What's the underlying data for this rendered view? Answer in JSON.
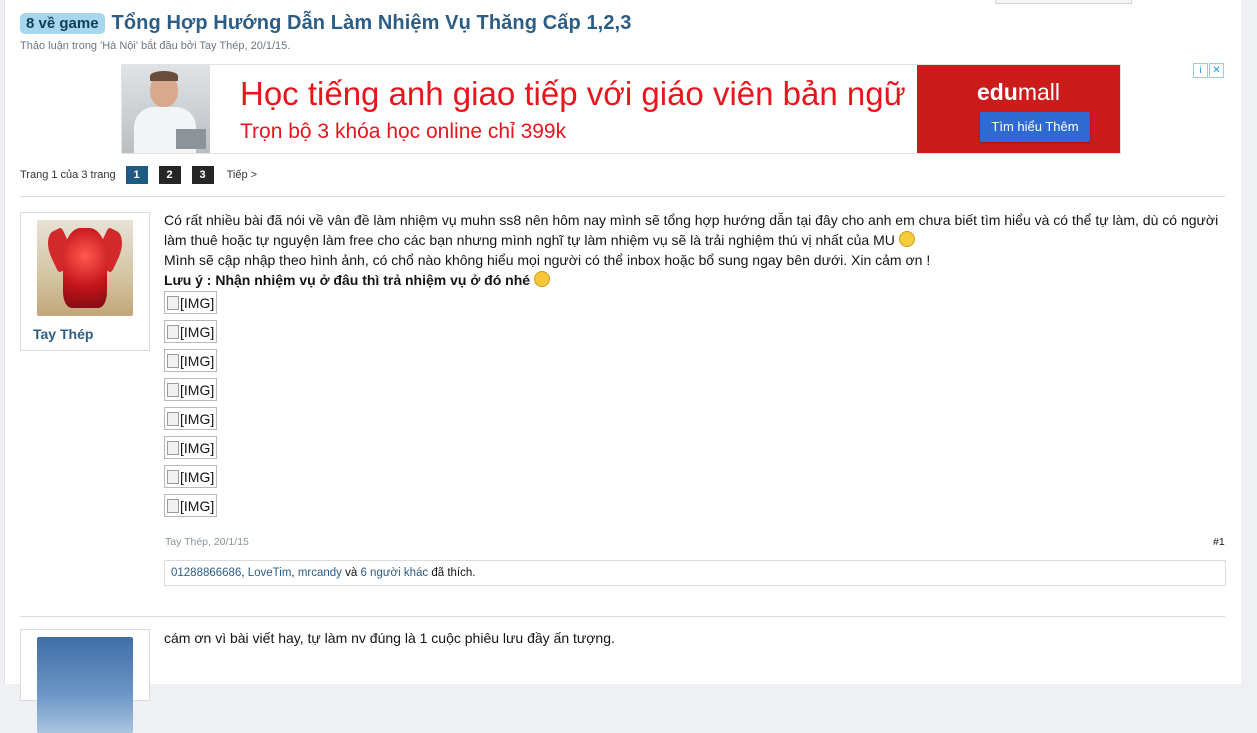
{
  "thread": {
    "prefix": "8 về game",
    "title": "Tổng Hợp Hướng Dẫn Làm Nhiệm Vụ Thăng Cấp 1,2,3",
    "meta": {
      "discussion_in": "Thảo luận trong",
      "forum": "'Hà Nội'",
      "started_by": "bắt đầu bởi",
      "author": "Tay Thép",
      "date": ", 20/1/15."
    }
  },
  "ad": {
    "headline": "Học tiếng anh giao tiếp với giáo viên bản ngữ",
    "subline": "Trọn bộ 3 khóa học online chỉ 399k",
    "brand_bold": "edu",
    "brand_rest": "mall",
    "cta": "Tìm hiểu Thêm",
    "choices_info": "i",
    "choices_close": "✕",
    "colors": {
      "text": "#e8151c",
      "brand_bg": "#cc1b1b",
      "cta_bg": "#2e6ad1"
    }
  },
  "pagination": {
    "label": "Trang 1 của 3 trang",
    "pages": [
      "1",
      "2",
      "3"
    ],
    "current": "1",
    "next": "Tiếp >"
  },
  "posts": [
    {
      "username": "Tay Thép",
      "lines": [
        "Có rất nhiều bài đã nói về vân đề làm nhiệm vụ muhn ss8 nên hôm nay mình sẽ tổng hợp hướng dẫn tại đây cho anh em chưa biết tìm hiểu và có thể tự làm, dù có người làm thuê hoặc tự nguyện làm free cho các bạn nhưng mình nghĩ tự làm nhiệm vụ sẽ là trải nghiệm thú vị nhất của MU",
        "Mình sẽ cập nhập theo hình ảnh, có chổ nào không hiểu mọi người có thể inbox hoặc bổ sung ngay bên dưới. Xin cảm ơn !",
        "Lưu ý : Nhận nhiệm vụ ở đâu thì trả nhiệm vụ ở đó nhé"
      ],
      "images": [
        "[IMG]",
        "[IMG]",
        "[IMG]",
        "[IMG]",
        "[IMG]",
        "[IMG]",
        "[IMG]",
        "[IMG]"
      ],
      "footer_author": "Tay Thép",
      "footer_date": ", 20/1/15",
      "number": "#1",
      "likes": {
        "users": [
          "01288866686",
          "LoveTim",
          "mrcandy"
        ],
        "sep1": ", ",
        "sep2": ", ",
        "and": " và ",
        "others": "6 người khác",
        "suffix": " đã thích."
      }
    },
    {
      "text": "cám ơn vì bài viết hay, tự làm nv đúng là 1 cuộc phiêu lưu đầy ấn tượng."
    }
  ]
}
